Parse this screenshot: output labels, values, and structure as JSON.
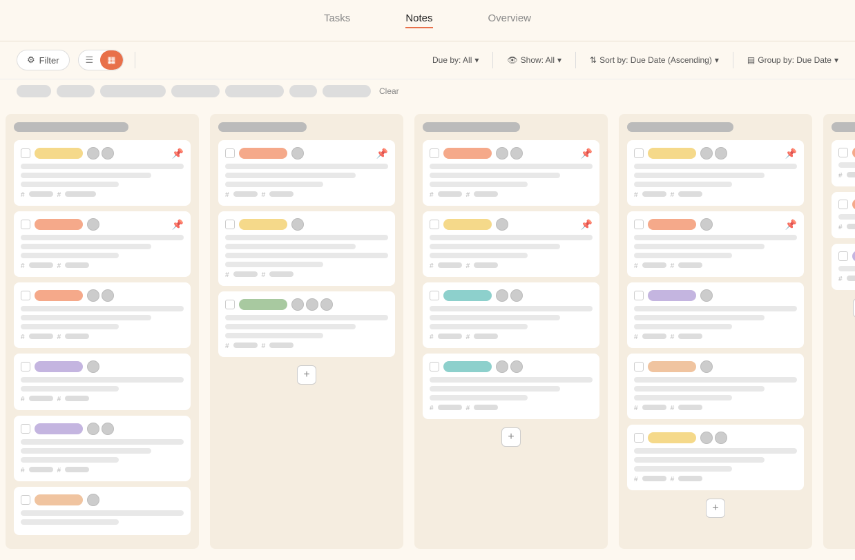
{
  "nav": {
    "tabs": [
      {
        "id": "tasks",
        "label": "Tasks",
        "active": true
      },
      {
        "id": "notes",
        "label": "Notes",
        "active": false
      },
      {
        "id": "overview",
        "label": "Overview",
        "active": false
      }
    ]
  },
  "toolbar": {
    "filter_label": "Filter",
    "due_by_label": "Due by: All",
    "show_label": "Show: All",
    "sort_label": "Sort by: Due Date (Ascending)",
    "group_label": "Group by: Due Date",
    "clear_label": "Clear"
  },
  "columns": [
    {
      "id": "col1",
      "cards": [
        {
          "tag": "yellow",
          "avatars": 2,
          "pinned": true,
          "lines": [
            3,
            2,
            2
          ],
          "tags": 2
        },
        {
          "tag": "orange",
          "avatars": 1,
          "pinned": true,
          "lines": [
            3,
            2,
            2
          ],
          "tags": 2
        },
        {
          "tag": "orange",
          "avatars": 2,
          "pinned": false,
          "lines": [
            3,
            2,
            2
          ],
          "tags": 2
        },
        {
          "tag": "purple",
          "avatars": 1,
          "pinned": false,
          "lines": [
            3,
            1,
            2
          ],
          "tags": 2
        },
        {
          "tag": "purple",
          "avatars": 2,
          "pinned": false,
          "lines": [
            3,
            2,
            2
          ],
          "tags": 2
        },
        {
          "tag": "peach",
          "avatars": 1,
          "pinned": false,
          "lines": [
            2,
            1
          ],
          "tags": 0
        }
      ]
    },
    {
      "id": "col2",
      "cards": [
        {
          "tag": "orange",
          "avatars": 1,
          "pinned": true,
          "lines": [
            3,
            2,
            2
          ],
          "tags": 2
        },
        {
          "tag": "yellow",
          "avatars": 1,
          "pinned": false,
          "lines": [
            3,
            2,
            2
          ],
          "tags": 2
        },
        {
          "tag": "green",
          "avatars": 3,
          "pinned": false,
          "lines": [
            3,
            2,
            2
          ],
          "tags": 2
        }
      ],
      "add_card": true
    },
    {
      "id": "col3",
      "cards": [
        {
          "tag": "orange",
          "avatars": 2,
          "pinned": true,
          "lines": [
            3,
            2,
            2
          ],
          "tags": 2
        },
        {
          "tag": "yellow",
          "avatars": 1,
          "pinned": true,
          "lines": [
            3,
            2,
            2
          ],
          "tags": 2
        },
        {
          "tag": "teal",
          "avatars": 2,
          "pinned": false,
          "lines": [
            3,
            2,
            2
          ],
          "tags": 2
        },
        {
          "tag": "teal",
          "avatars": 2,
          "pinned": false,
          "lines": [
            3,
            2,
            2
          ],
          "tags": 2
        }
      ],
      "add_card": true
    },
    {
      "id": "col4",
      "cards": [
        {
          "tag": "yellow",
          "avatars": 2,
          "pinned": true,
          "lines": [
            3,
            2,
            2
          ],
          "tags": 2
        },
        {
          "tag": "orange",
          "avatars": 1,
          "pinned": true,
          "lines": [
            3,
            2,
            2
          ],
          "tags": 2
        },
        {
          "tag": "purple",
          "avatars": 1,
          "pinned": false,
          "lines": [
            3,
            2,
            2
          ],
          "tags": 2
        },
        {
          "tag": "peach",
          "avatars": 1,
          "pinned": false,
          "lines": [
            3,
            2,
            2
          ],
          "tags": 2
        },
        {
          "tag": "yellow",
          "avatars": 2,
          "pinned": false,
          "lines": [
            3,
            2,
            2
          ],
          "tags": 2
        }
      ],
      "add_card": true
    },
    {
      "id": "col5",
      "cards": [
        {
          "tag": "orange",
          "avatars": 0,
          "pinned": false,
          "lines": [
            3,
            2
          ],
          "tags": 2
        },
        {
          "tag": "orange",
          "avatars": 0,
          "pinned": false,
          "lines": [
            3,
            2
          ],
          "tags": 2
        },
        {
          "tag": "purple",
          "avatars": 0,
          "pinned": false,
          "lines": [
            3,
            2
          ],
          "tags": 2
        }
      ],
      "add_card": true,
      "partial": true
    }
  ],
  "icons": {
    "filter": "⚙",
    "list": "☰",
    "board": "▦",
    "pin": "📌",
    "plus": "+",
    "chevron": "▾",
    "eye": "👁",
    "sort": "⇅",
    "group": "▤"
  }
}
